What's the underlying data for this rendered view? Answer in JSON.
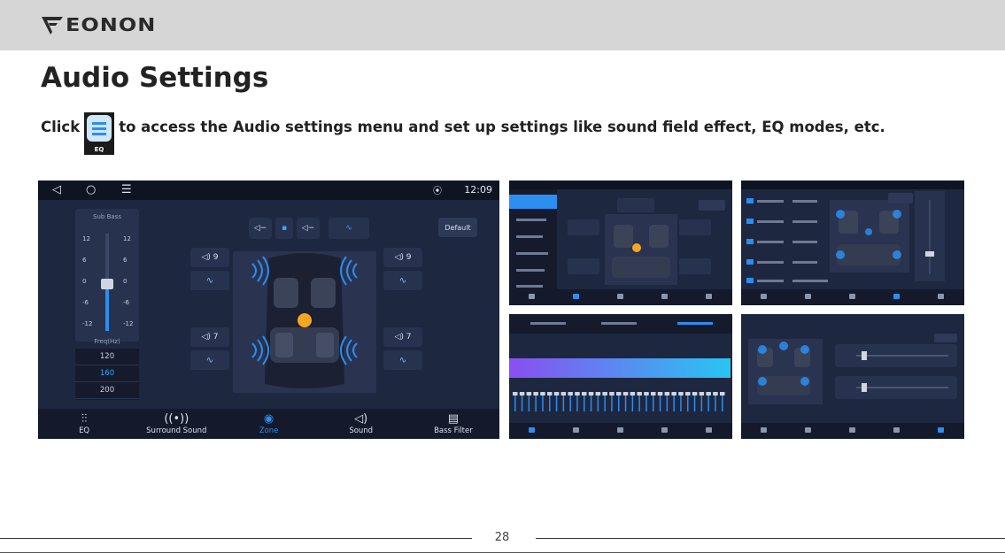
{
  "brand": {
    "name": "EONON"
  },
  "page": {
    "title": "Audio Settings",
    "page_number": "28"
  },
  "instruction": {
    "prefix": "Click",
    "suffix": "to access the Audio settings menu and set up settings like sound field effect, EQ modes, etc.",
    "app_icon_label": "EQ"
  },
  "main_screen": {
    "clock": "12:09",
    "fader": {
      "title": "Sub Bass",
      "scale_left": [
        "12",
        "6",
        "0",
        "-6",
        "-12"
      ],
      "scale_right": [
        "12",
        "6",
        "0",
        "-6",
        "-12"
      ],
      "level": 0.48
    },
    "frequency": {
      "label": "Freq(Hz)",
      "options": [
        "120",
        "160",
        "200"
      ],
      "selected": "160"
    },
    "default_button": "Default",
    "speakers": {
      "front_left": "9",
      "front_right": "9",
      "rear_left": "7",
      "rear_right": "7"
    },
    "nav": [
      {
        "label": "EQ",
        "icon": "equalizer-icon"
      },
      {
        "label": "Surround Sound",
        "icon": "surround-icon"
      },
      {
        "label": "Zone",
        "icon": "zone-target-icon"
      },
      {
        "label": "Sound",
        "icon": "speaker-icon"
      },
      {
        "label": "Bass Filter",
        "icon": "bass-filter-icon"
      }
    ],
    "active_nav": "Zone"
  },
  "colors": {
    "screen_bg": "#1d2740",
    "accent_blue": "#2b8ef0",
    "seat_dot": "#f5a623",
    "eq_gradient_start": "#8a4ff0",
    "eq_gradient_end": "#27c6f2"
  }
}
